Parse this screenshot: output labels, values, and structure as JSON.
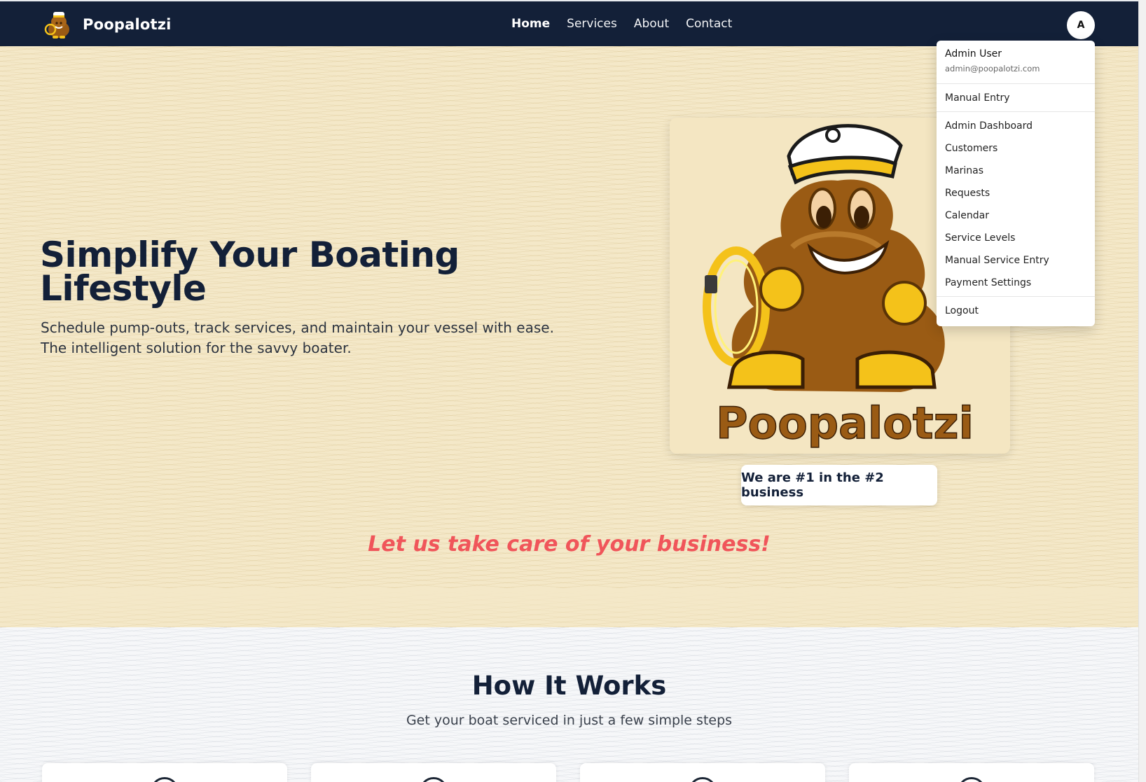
{
  "brand": {
    "name": "Poopalotzi",
    "logo_icon": "poop-captain-mascot-icon"
  },
  "nav": {
    "links": [
      {
        "label": "Home",
        "active": true
      },
      {
        "label": "Services",
        "active": false
      },
      {
        "label": "About",
        "active": false
      },
      {
        "label": "Contact",
        "active": false
      }
    ]
  },
  "user": {
    "avatar_initial": "A",
    "name": "Admin User",
    "email": "admin@poopalotzi.com"
  },
  "dropdown": {
    "manual_entry": "Manual Entry",
    "items": [
      "Admin Dashboard",
      "Customers",
      "Marinas",
      "Requests",
      "Calendar",
      "Service Levels",
      "Manual Service Entry",
      "Payment Settings"
    ],
    "logout": "Logout"
  },
  "hero": {
    "title": "Simplify Your Boating Lifestyle",
    "subtitle": "Schedule pump-outs, track services, and maintain your vessel with ease. The intelligent solution for the savvy boater.",
    "mascot_wordmark": "Poopalotzi",
    "tagline": "We are #1 in the #2 business",
    "business_line": "Let us take care of your business!"
  },
  "how_it_works": {
    "title": "How It Works",
    "subtitle": "Get your boat serviced in just a few simple steps"
  },
  "colors": {
    "navy": "#132038",
    "sand": "#f4e8c8",
    "accent_red": "#f0555a",
    "mascot_brown": "#9a5b14",
    "gold": "#f4c21a"
  }
}
